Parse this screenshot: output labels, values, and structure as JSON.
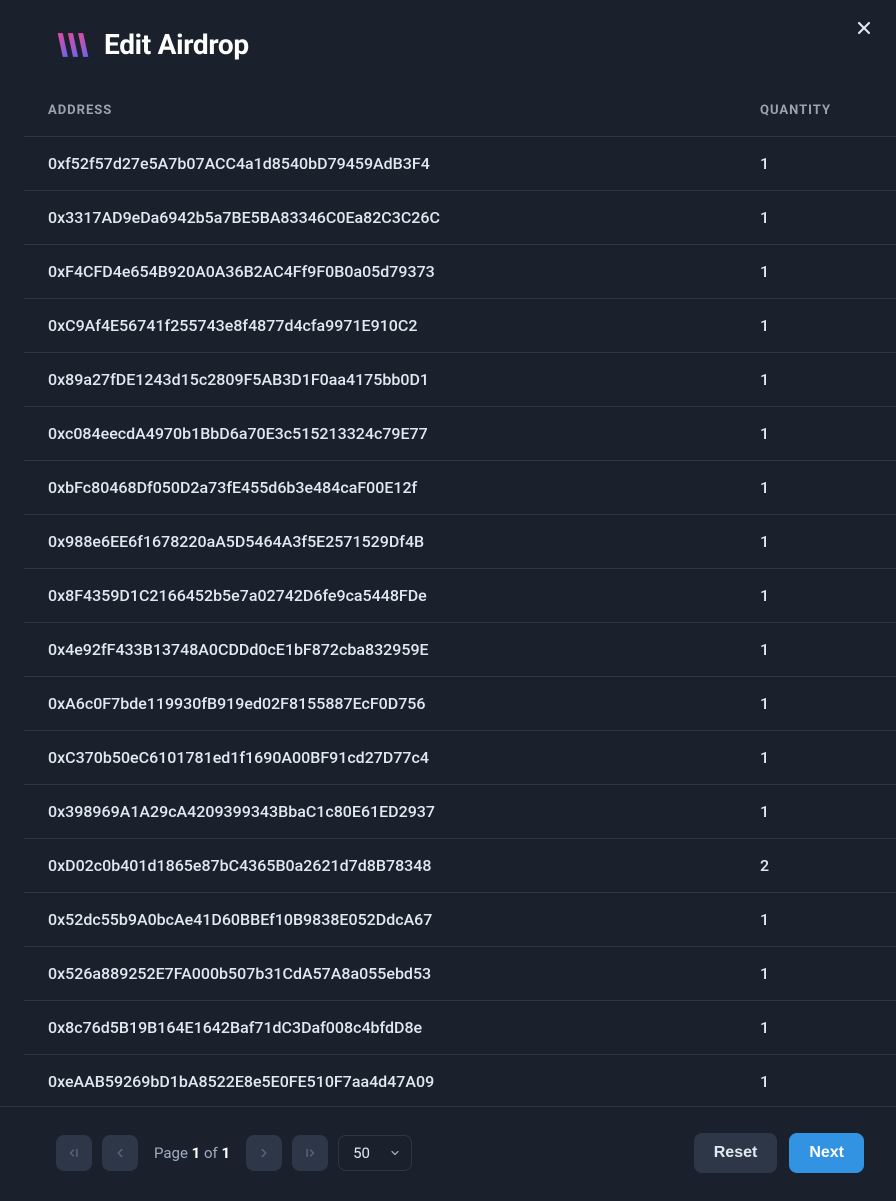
{
  "header": {
    "title": "Edit Airdrop"
  },
  "table": {
    "columns": {
      "address": "ADDRESS",
      "quantity": "QUANTITY"
    },
    "rows": [
      {
        "address": "0xf52f57d27e5A7b07ACC4a1d8540bD79459AdB3F4",
        "quantity": "1"
      },
      {
        "address": "0x3317AD9eDa6942b5a7BE5BA83346C0Ea82C3C26C",
        "quantity": "1"
      },
      {
        "address": "0xF4CFD4e654B920A0A36B2AC4Ff9F0B0a05d79373",
        "quantity": "1"
      },
      {
        "address": "0xC9Af4E56741f255743e8f4877d4cfa9971E910C2",
        "quantity": "1"
      },
      {
        "address": "0x89a27fDE1243d15c2809F5AB3D1F0aa4175bb0D1",
        "quantity": "1"
      },
      {
        "address": "0xc084eecdA4970b1BbD6a70E3c515213324c79E77",
        "quantity": "1"
      },
      {
        "address": "0xbFc80468Df050D2a73fE455d6b3e484caF00E12f",
        "quantity": "1"
      },
      {
        "address": "0x988e6EE6f1678220aA5D5464A3f5E2571529Df4B",
        "quantity": "1"
      },
      {
        "address": "0x8F4359D1C2166452b5e7a02742D6fe9ca5448FDe",
        "quantity": "1"
      },
      {
        "address": "0x4e92fF433B13748A0CDDd0cE1bF872cba832959E",
        "quantity": "1"
      },
      {
        "address": "0xA6c0F7bde119930fB919ed02F8155887EcF0D756",
        "quantity": "1"
      },
      {
        "address": "0xC370b50eC6101781ed1f1690A00BF91cd27D77c4",
        "quantity": "1"
      },
      {
        "address": "0x398969A1A29cA4209399343BbaC1c80E61ED2937",
        "quantity": "1"
      },
      {
        "address": "0xD02c0b401d1865e87bC4365B0a2621d7d8B78348",
        "quantity": "2"
      },
      {
        "address": "0x52dc55b9A0bcAe41D60BBEf10B9838E052DdcA67",
        "quantity": "1"
      },
      {
        "address": "0x526a889252E7FA000b507b31CdA57A8a055ebd53",
        "quantity": "1"
      },
      {
        "address": "0x8c76d5B19B164E1642Baf71dC3Daf008c4bfdD8e",
        "quantity": "1"
      },
      {
        "address": "0xeAAB59269bD1bA8522E8e5E0FE510F7aa4d47A09",
        "quantity": "1"
      }
    ]
  },
  "pagination": {
    "label_prefix": "Page ",
    "current": "1",
    "of": " of ",
    "total": "1",
    "page_size": "50"
  },
  "actions": {
    "reset": "Reset",
    "next": "Next"
  }
}
